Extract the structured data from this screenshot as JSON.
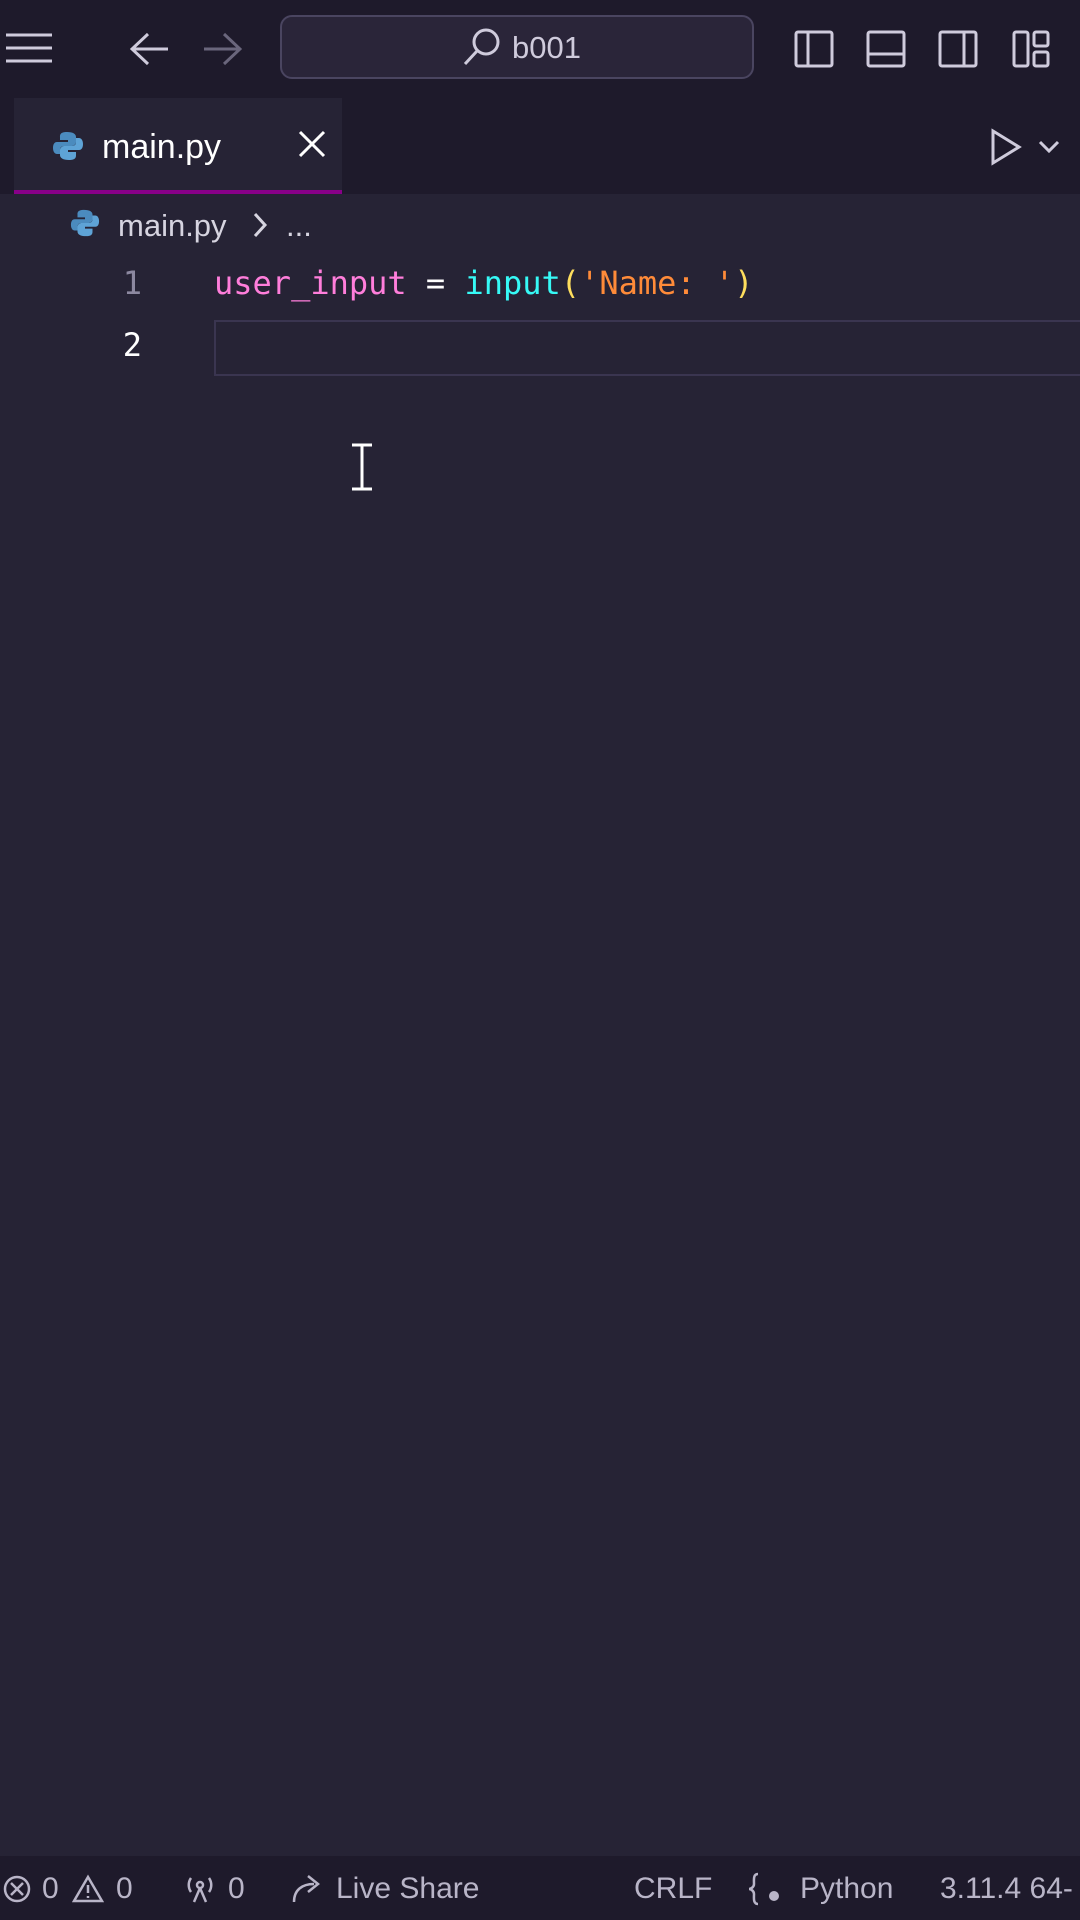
{
  "titlebar": {
    "search_text": "b001",
    "icons": [
      "menu-icon",
      "arrow-left-icon",
      "arrow-right-icon",
      "search-icon",
      "toggle-primary-sidebar-icon",
      "toggle-panel-icon",
      "toggle-secondary-sidebar-icon",
      "customize-layout-icon"
    ]
  },
  "tab": {
    "label": "main.py",
    "accent": "#880088"
  },
  "breadcrumb": {
    "file": "main.py",
    "ellipsis": "..."
  },
  "editor": {
    "lines": [
      {
        "number": "1",
        "tokens": [
          "user_input",
          " = ",
          "input",
          "(",
          "'Name: '",
          ")"
        ]
      },
      {
        "number": "2",
        "tokens": []
      }
    ]
  },
  "status": {
    "errors": "0",
    "warnings": "0",
    "ports": "0",
    "live_share": "Live Share",
    "eol": "CRLF",
    "language": "Python",
    "interpreter": "3.11.4 64-"
  },
  "colors": {
    "background": "#262335",
    "chrome": "#1e1a2b",
    "variable": "#ff7edb",
    "function": "#36f9f6",
    "string": "#ff8b39",
    "paren": "#fede5d"
  }
}
